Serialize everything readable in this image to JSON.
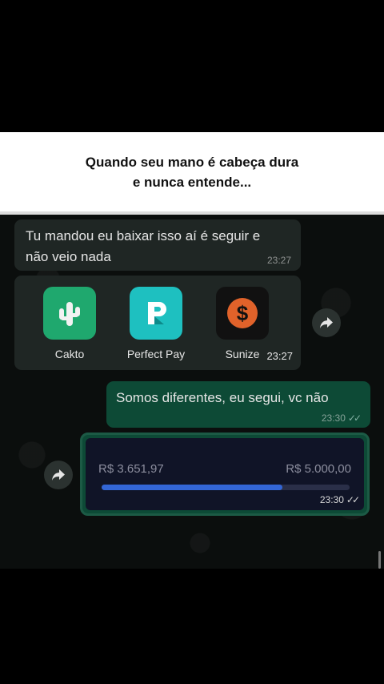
{
  "caption": {
    "line1": "Quando seu mano é cabeça dura",
    "line2": "e nunca entende..."
  },
  "messages": {
    "first": {
      "text_line1": "Tu mandou eu baixar isso aí é seguir e",
      "text_line2": "não veio nada",
      "time": "23:27"
    },
    "apps": {
      "items": [
        {
          "label": "Cakto",
          "icon": "cactus-icon",
          "color": "#1fa86e"
        },
        {
          "label": "Perfect Pay",
          "icon": "perfect-pay-logo-icon",
          "color": "#1ec0c0"
        },
        {
          "label": "Sunize",
          "icon": "sunize-dollar-icon",
          "color": "#e0622a"
        }
      ],
      "time": "23:27"
    },
    "reply": {
      "text": "Somos diferentes, eu segui, vc não",
      "time": "23:30"
    },
    "progress": {
      "current": "R$ 3.651,97",
      "goal": "R$ 5.000,00",
      "fraction": 0.73,
      "time": "23:30"
    }
  },
  "colors": {
    "incoming_bubble": "#1f2624",
    "outgoing_bubble": "#0d4a36",
    "progress_fill": "#3366d6"
  }
}
